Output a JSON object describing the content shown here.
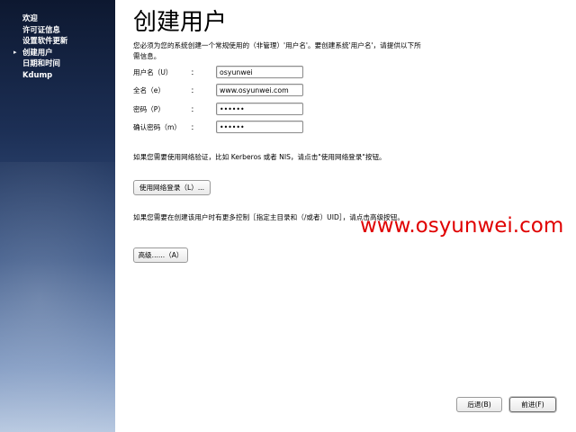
{
  "sidebar": {
    "items": [
      {
        "label": "欢迎",
        "current": false
      },
      {
        "label": "许可证信息",
        "current": false
      },
      {
        "label": "设置软件更新",
        "current": false
      },
      {
        "label": "创建用户",
        "current": true
      },
      {
        "label": "日期和时间",
        "current": false
      },
      {
        "label": "Kdump",
        "current": false
      }
    ],
    "current_marker": "▸"
  },
  "main": {
    "title": "创建用户",
    "intro": "您必须为您的系统创建一个常规使用的（非管理）'用户名'。要创建系统'用户名'，请提供以下所需信息。",
    "fields": {
      "username": {
        "label": "用户名（U）",
        "colon": "：",
        "value": "osyunwei"
      },
      "fullname": {
        "label": "全名（e）",
        "colon": "：",
        "value": "www.osyunwei.com"
      },
      "password": {
        "label": "密码（P）",
        "colon": "：",
        "value": "123456"
      },
      "confirm": {
        "label": "确认密码（m）",
        "colon": "：",
        "value": "123456"
      }
    },
    "network_text": "如果您需要使用网络验证，比如 Kerberos 或者 NIS，请点击\"使用网络登录\"按钮。",
    "network_button": "使用网络登录（L）...",
    "advanced_text": "如果您需要在创建该用户时有更多控制［指定主目录和（/或者）UID］，请点击高级按钮。",
    "advanced_button": "高级......（A）",
    "back_button": "后退(B)",
    "forward_button": "前进(F)"
  },
  "watermark": "www.osyunwei.com"
}
